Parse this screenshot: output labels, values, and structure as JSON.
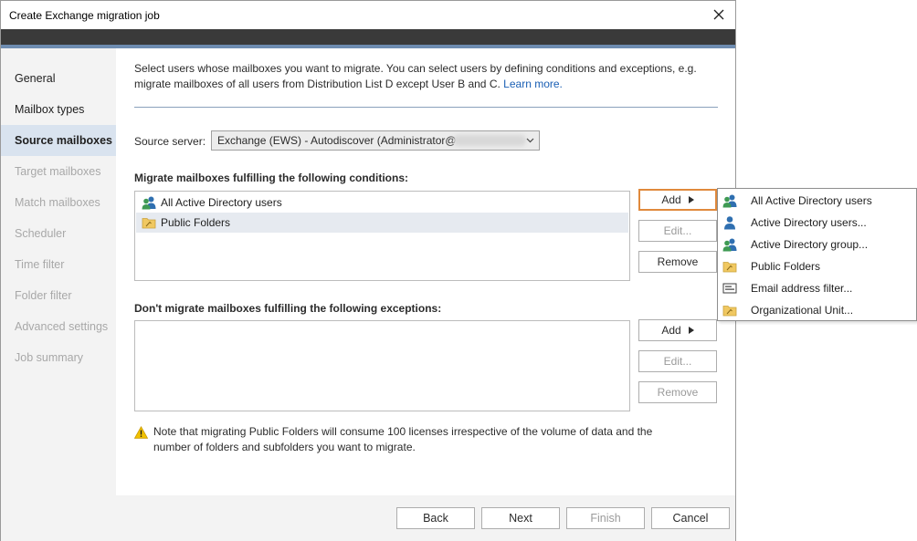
{
  "window": {
    "title": "Create Exchange migration job"
  },
  "nav": {
    "items": [
      {
        "label": "General",
        "state": "normal"
      },
      {
        "label": "Mailbox types",
        "state": "normal"
      },
      {
        "label": "Source mailboxes",
        "state": "active"
      },
      {
        "label": "Target mailboxes",
        "state": "disabled"
      },
      {
        "label": "Match mailboxes",
        "state": "disabled"
      },
      {
        "label": "Scheduler",
        "state": "disabled"
      },
      {
        "label": "Time filter",
        "state": "disabled"
      },
      {
        "label": "Folder filter",
        "state": "disabled"
      },
      {
        "label": "Advanced settings",
        "state": "disabled"
      },
      {
        "label": "Job summary",
        "state": "disabled"
      }
    ]
  },
  "intro": {
    "text": "Select users whose mailboxes you want to migrate. You can select users by defining conditions and exceptions, e.g. migrate mailboxes of all users from Distribution List D except User B and C.",
    "link": "Learn more."
  },
  "source_server": {
    "label": "Source server:",
    "value": "Exchange (EWS) - Autodiscover (Administrator@"
  },
  "conditions": {
    "heading": "Migrate mailboxes fulfilling the following conditions:",
    "items": [
      {
        "label": "All Active Directory users",
        "icon": "users-icon",
        "selected": false
      },
      {
        "label": "Public Folders",
        "icon": "public-folder-icon",
        "selected": true
      }
    ],
    "add_label": "Add",
    "edit_label": "Edit...",
    "remove_label": "Remove"
  },
  "exceptions": {
    "heading": "Don't migrate mailboxes fulfilling the following exceptions:",
    "items": [],
    "add_label": "Add",
    "edit_label": "Edit...",
    "remove_label": "Remove"
  },
  "warning": {
    "icon": "warning-icon",
    "text": "Note that migrating Public Folders will consume 100 licenses irrespective of the volume of data and the number of folders and subfolders you want to migrate."
  },
  "footer": {
    "back": "Back",
    "next": "Next",
    "finish": "Finish",
    "cancel": "Cancel"
  },
  "add_menu": {
    "items": [
      {
        "label": "All Active Directory users",
        "icon": "users-icon"
      },
      {
        "label": "Active Directory users...",
        "icon": "user-icon"
      },
      {
        "label": "Active Directory group...",
        "icon": "group-icon"
      },
      {
        "label": "Public Folders",
        "icon": "public-folder-icon"
      },
      {
        "label": "Email address filter...",
        "icon": "email-filter-icon"
      },
      {
        "label": "Organizational Unit...",
        "icon": "org-unit-icon"
      }
    ]
  },
  "colors": {
    "accent_bar": "#6e8cb0",
    "title_dark_bar": "#3a3a3a",
    "nav_active_bg": "#d9e3ef",
    "focus_border": "#e0893c",
    "link": "#1a5fb4"
  }
}
